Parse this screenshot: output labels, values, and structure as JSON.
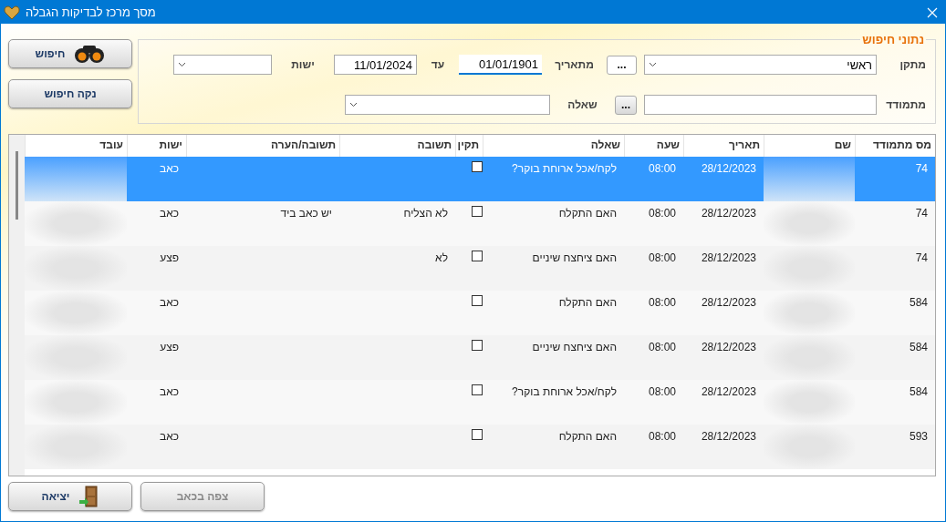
{
  "window": {
    "title": "מסך מרכז לבדיקות הגבלה"
  },
  "search_panel": {
    "title": "נתוני חיפוש",
    "facility": {
      "label": "מתקן",
      "value": "ראשי",
      "browse": "..."
    },
    "from_date": {
      "label": "מתאריך",
      "value": "01/01/1901",
      "focused": true
    },
    "to_date": {
      "label": "עד",
      "value": "11/01/2024",
      "focused": false
    },
    "entity": {
      "label": "ישות"
    },
    "contestant": {
      "label": "מתמודד",
      "browse": "..."
    },
    "question": {
      "label": "שאלה"
    }
  },
  "actions": [
    {
      "label": "חיפוש",
      "kind": "search"
    },
    {
      "label": "נקה חיפוש",
      "kind": "plain"
    }
  ],
  "table": {
    "columns": [
      "מס מתמודד",
      "שם",
      "תאריך",
      "שעה",
      "שאלה",
      "תקין",
      "תשובה",
      "תשובה/הערה",
      "ישות",
      "עובד"
    ],
    "rows": [
      {
        "contestant_no": "74",
        "date": "28/12/2023",
        "time": "08:00",
        "question": "לקח/אכל ארוחת בוקר?",
        "valid": false,
        "entity": "כאב",
        "selected": true
      },
      {
        "contestant_no": "74",
        "date": "28/12/2023",
        "time": "08:00",
        "question": "האם התקלח",
        "valid": false,
        "answer": "לא הצליח",
        "comment": "יש כאב ביד",
        "entity": "כאב",
        "selected": false
      },
      {
        "contestant_no": "74",
        "date": "28/12/2023",
        "time": "08:00",
        "question": "האם ציחצח שיניים",
        "valid": false,
        "answer": "לא",
        "entity": "פצע",
        "selected": false
      },
      {
        "contestant_no": "584",
        "date": "28/12/2023",
        "time": "08:00",
        "question": "האם התקלח",
        "valid": false,
        "entity": "כאב",
        "selected": false
      },
      {
        "contestant_no": "584",
        "date": "28/12/2023",
        "time": "08:00",
        "question": "האם ציחצח שיניים",
        "valid": false,
        "entity": "פצע",
        "selected": false
      },
      {
        "contestant_no": "584",
        "date": "28/12/2023",
        "time": "08:00",
        "question": "לקח/אכל ארוחת בוקר?",
        "valid": false,
        "entity": "כאב",
        "selected": false
      },
      {
        "contestant_no": "593",
        "date": "28/12/2023",
        "time": "08:00",
        "question": "האם התקלח",
        "valid": false,
        "entity": "כאב",
        "selected": false
      }
    ]
  },
  "footer_buttons": [
    {
      "label": "צפה בכאב",
      "kind": "plain",
      "disabled": true
    },
    {
      "label": "יציאה",
      "kind": "exit",
      "disabled": false
    }
  ]
}
